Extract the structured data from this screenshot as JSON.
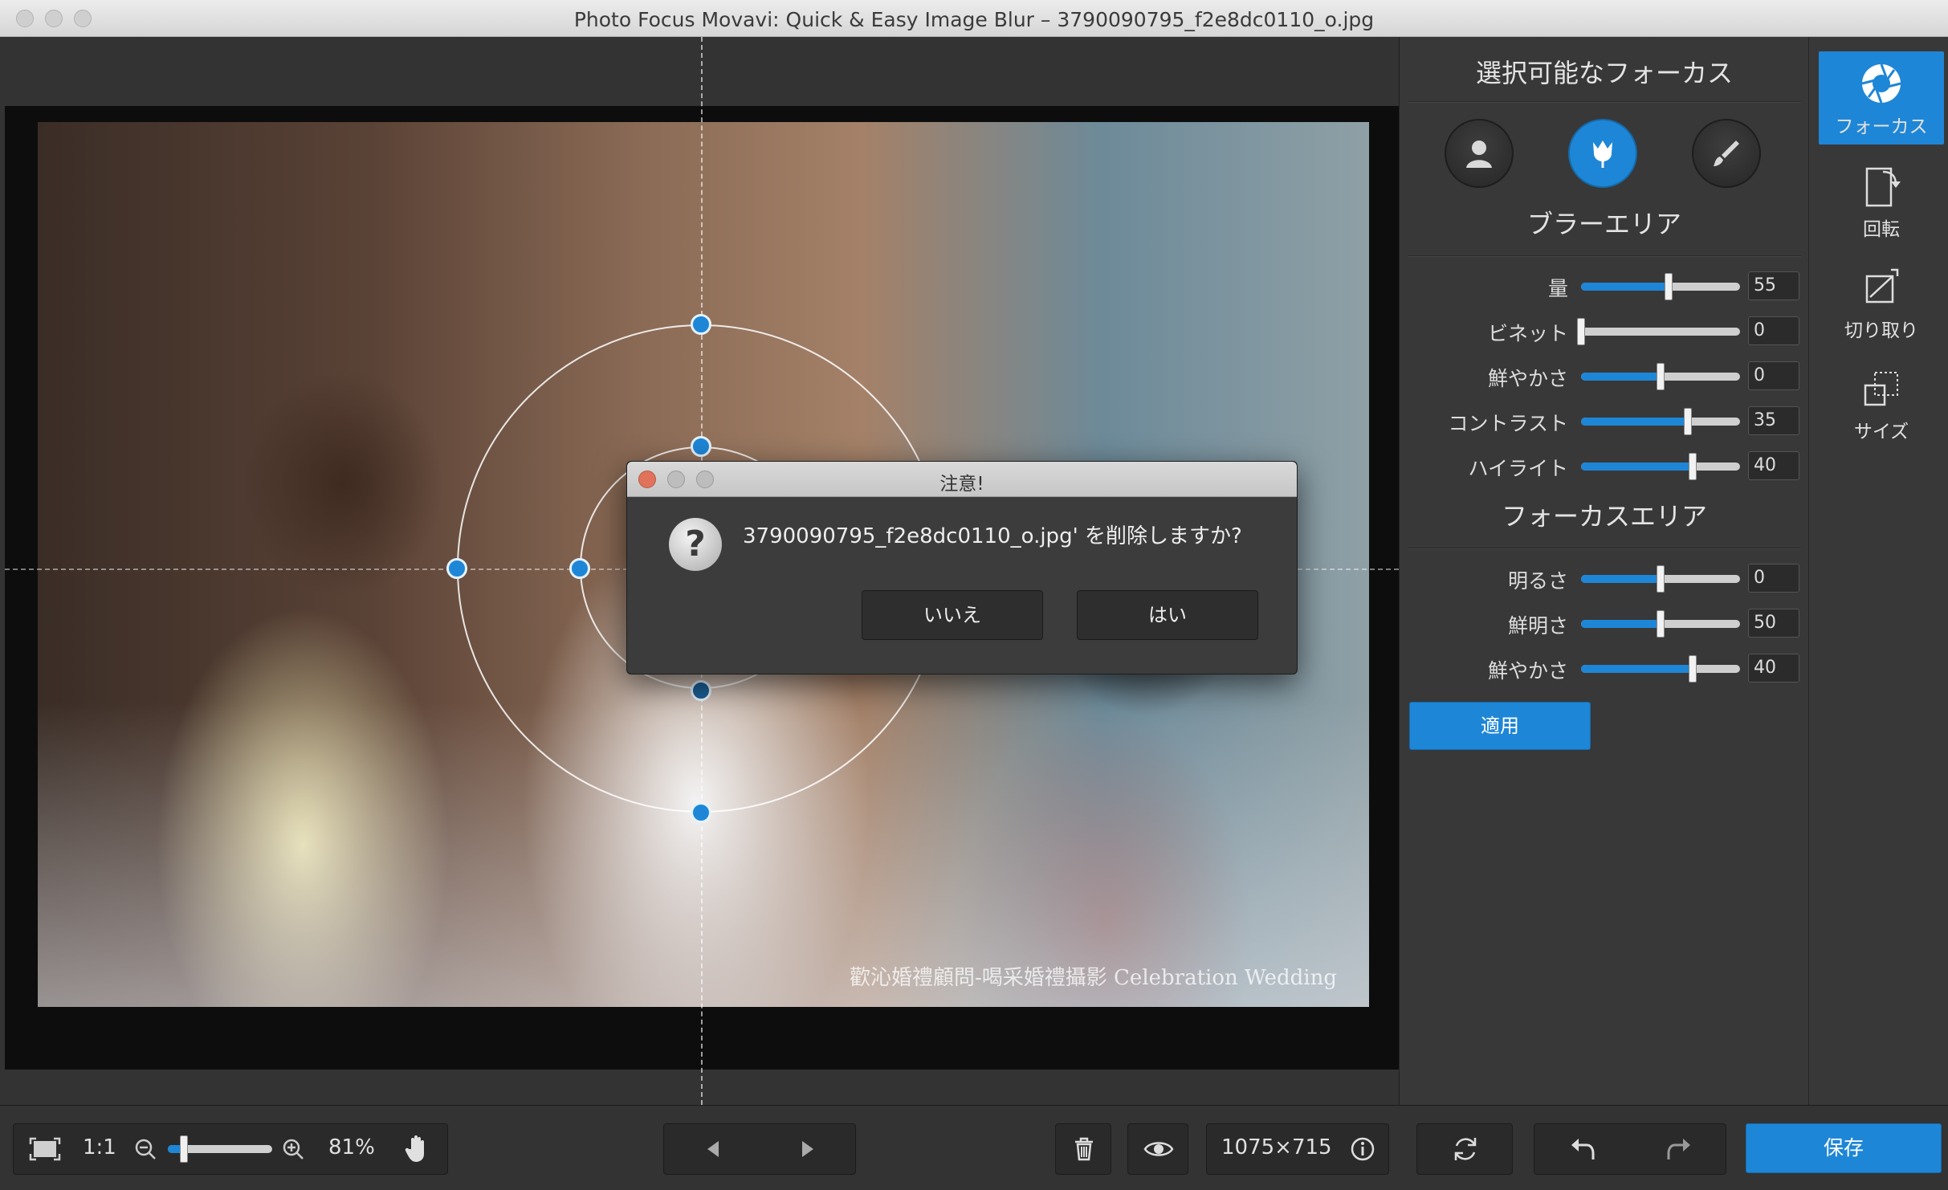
{
  "window": {
    "title": "Photo Focus Movavi: Quick & Easy Image Blur – 3790090795_f2e8dc0110_o.jpg"
  },
  "image": {
    "watermark": "歡沁婚禮顧問-喝采婚禮攝影 Celebration Wedding"
  },
  "dialog": {
    "title": "注意!",
    "icon": "question-icon",
    "message": "3790090795_f2e8dc0110_o.jpg' を削除しますか?",
    "no_label": "いいえ",
    "yes_label": "はい"
  },
  "panel": {
    "header": "選択可能なフォーカス",
    "modes": [
      {
        "name": "portrait",
        "icon": "person-icon",
        "active": false
      },
      {
        "name": "macro",
        "icon": "tulip-icon",
        "active": true
      },
      {
        "name": "brush",
        "icon": "brush-icon",
        "active": false
      }
    ],
    "blur_header": "ブラーエリア",
    "blur_sliders": [
      {
        "label": "量",
        "value": "55",
        "level": 0.55
      },
      {
        "label": "ビネット",
        "value": "0",
        "level": 0.0
      },
      {
        "label": "鮮やかさ",
        "value": "0",
        "level": 0.5
      },
      {
        "label": "コントラスト",
        "value": "35",
        "level": 0.67
      },
      {
        "label": "ハイライト",
        "value": "40",
        "level": 0.7
      }
    ],
    "focus_header": "フォーカスエリア",
    "focus_sliders": [
      {
        "label": "明るさ",
        "value": "0",
        "level": 0.5
      },
      {
        "label": "鮮明さ",
        "value": "50",
        "level": 0.5
      },
      {
        "label": "鮮やかさ",
        "value": "40",
        "level": 0.7
      }
    ],
    "apply_label": "適用"
  },
  "tools": [
    {
      "label": "フォーカス",
      "icon": "aperture-icon",
      "active": true
    },
    {
      "label": "回転",
      "icon": "rotate-icon",
      "active": false
    },
    {
      "label": "切り取り",
      "icon": "crop-icon",
      "active": false
    },
    {
      "label": "サイズ",
      "icon": "resize-icon",
      "active": false
    }
  ],
  "bottombar": {
    "ratio_label": "1:1",
    "zoom": "81%",
    "zoom_level": 0.15,
    "dimensions": "1075×715",
    "save_label": "保存"
  },
  "colors": {
    "accent": "#1e86d6",
    "panel_bg": "#383838",
    "close_light": "#e0735a"
  }
}
